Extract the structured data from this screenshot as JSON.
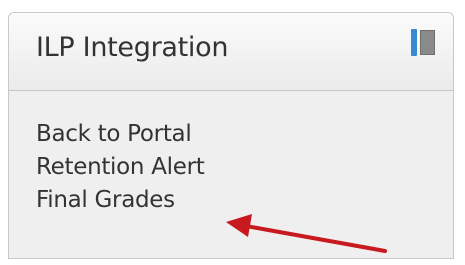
{
  "block": {
    "title": "ILP Integration",
    "icons": {
      "dock": "dock-toggle-icon"
    },
    "links": [
      {
        "label": "Back to Portal"
      },
      {
        "label": "Retention Alert"
      },
      {
        "label": "Final Grades"
      }
    ]
  },
  "annotation": {
    "arrow_color": "#c8191e",
    "points_to": "Final Grades"
  },
  "colors": {
    "header_bg": "#f4f4f4",
    "body_bg": "#efefef",
    "text": "#333333",
    "accent": "#3a88d0"
  }
}
